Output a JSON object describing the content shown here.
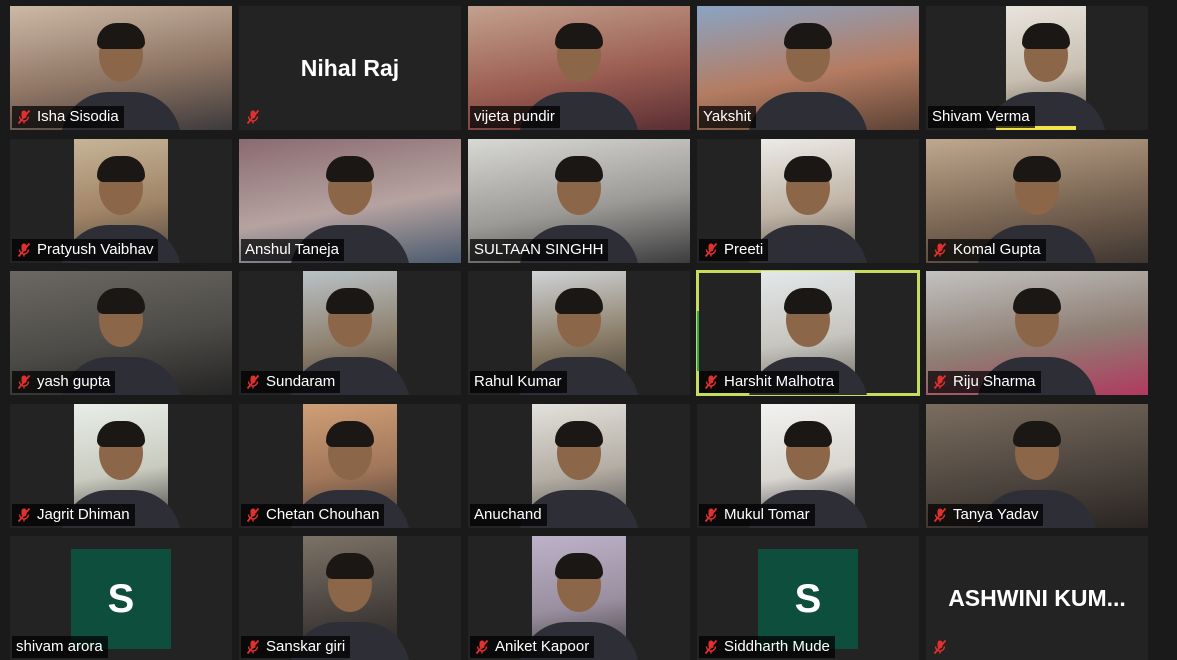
{
  "meeting": {
    "view": "gallery",
    "accent_active_speaker": "#c6dc5c",
    "avatar_color": "#0d4e3c",
    "tile_background": "#232323"
  },
  "participants": [
    {
      "name": "Isha Sisodia",
      "muted": true,
      "video": true
    },
    {
      "name": "Nihal Raj",
      "muted": true,
      "video": false,
      "display": "Nihal Raj"
    },
    {
      "name": "vijeta pundir",
      "muted": false,
      "video": true
    },
    {
      "name": "Yakshit",
      "muted": false,
      "video": true
    },
    {
      "name": "Shivam Verma",
      "muted": false,
      "video": true,
      "speaking": true
    },
    {
      "name": "Pratyush Vaibhav",
      "muted": true,
      "video": true
    },
    {
      "name": "Anshul Taneja",
      "muted": false,
      "video": true
    },
    {
      "name": "SULTAAN SINGHH",
      "muted": false,
      "video": true
    },
    {
      "name": "Preeti",
      "muted": true,
      "video": true
    },
    {
      "name": "Komal Gupta",
      "muted": true,
      "video": true
    },
    {
      "name": "yash gupta",
      "muted": true,
      "video": true
    },
    {
      "name": "Sundaram",
      "muted": true,
      "video": true
    },
    {
      "name": "Rahul Kumar",
      "muted": false,
      "video": true
    },
    {
      "name": "Harshit Malhotra",
      "muted": true,
      "video": true,
      "active": true
    },
    {
      "name": "Riju Sharma",
      "muted": true,
      "video": true
    },
    {
      "name": "Jagrit Dhiman",
      "muted": true,
      "video": true
    },
    {
      "name": "Chetan Chouhan",
      "muted": true,
      "video": true
    },
    {
      "name": "Anuchand",
      "muted": false,
      "video": true
    },
    {
      "name": "Mukul Tomar",
      "muted": true,
      "video": true
    },
    {
      "name": "Tanya Yadav",
      "muted": true,
      "video": true
    },
    {
      "name": "shivam arora",
      "muted": false,
      "video": false,
      "avatar": "S"
    },
    {
      "name": "Sanskar giri",
      "muted": true,
      "video": true
    },
    {
      "name": "Aniket Kapoor",
      "muted": true,
      "video": true
    },
    {
      "name": "Siddharth Mude",
      "muted": true,
      "video": false,
      "avatar": "S"
    },
    {
      "name": "ASHWINI KUM...",
      "muted": true,
      "video": false,
      "display": "ASHWINI KUM..."
    }
  ]
}
